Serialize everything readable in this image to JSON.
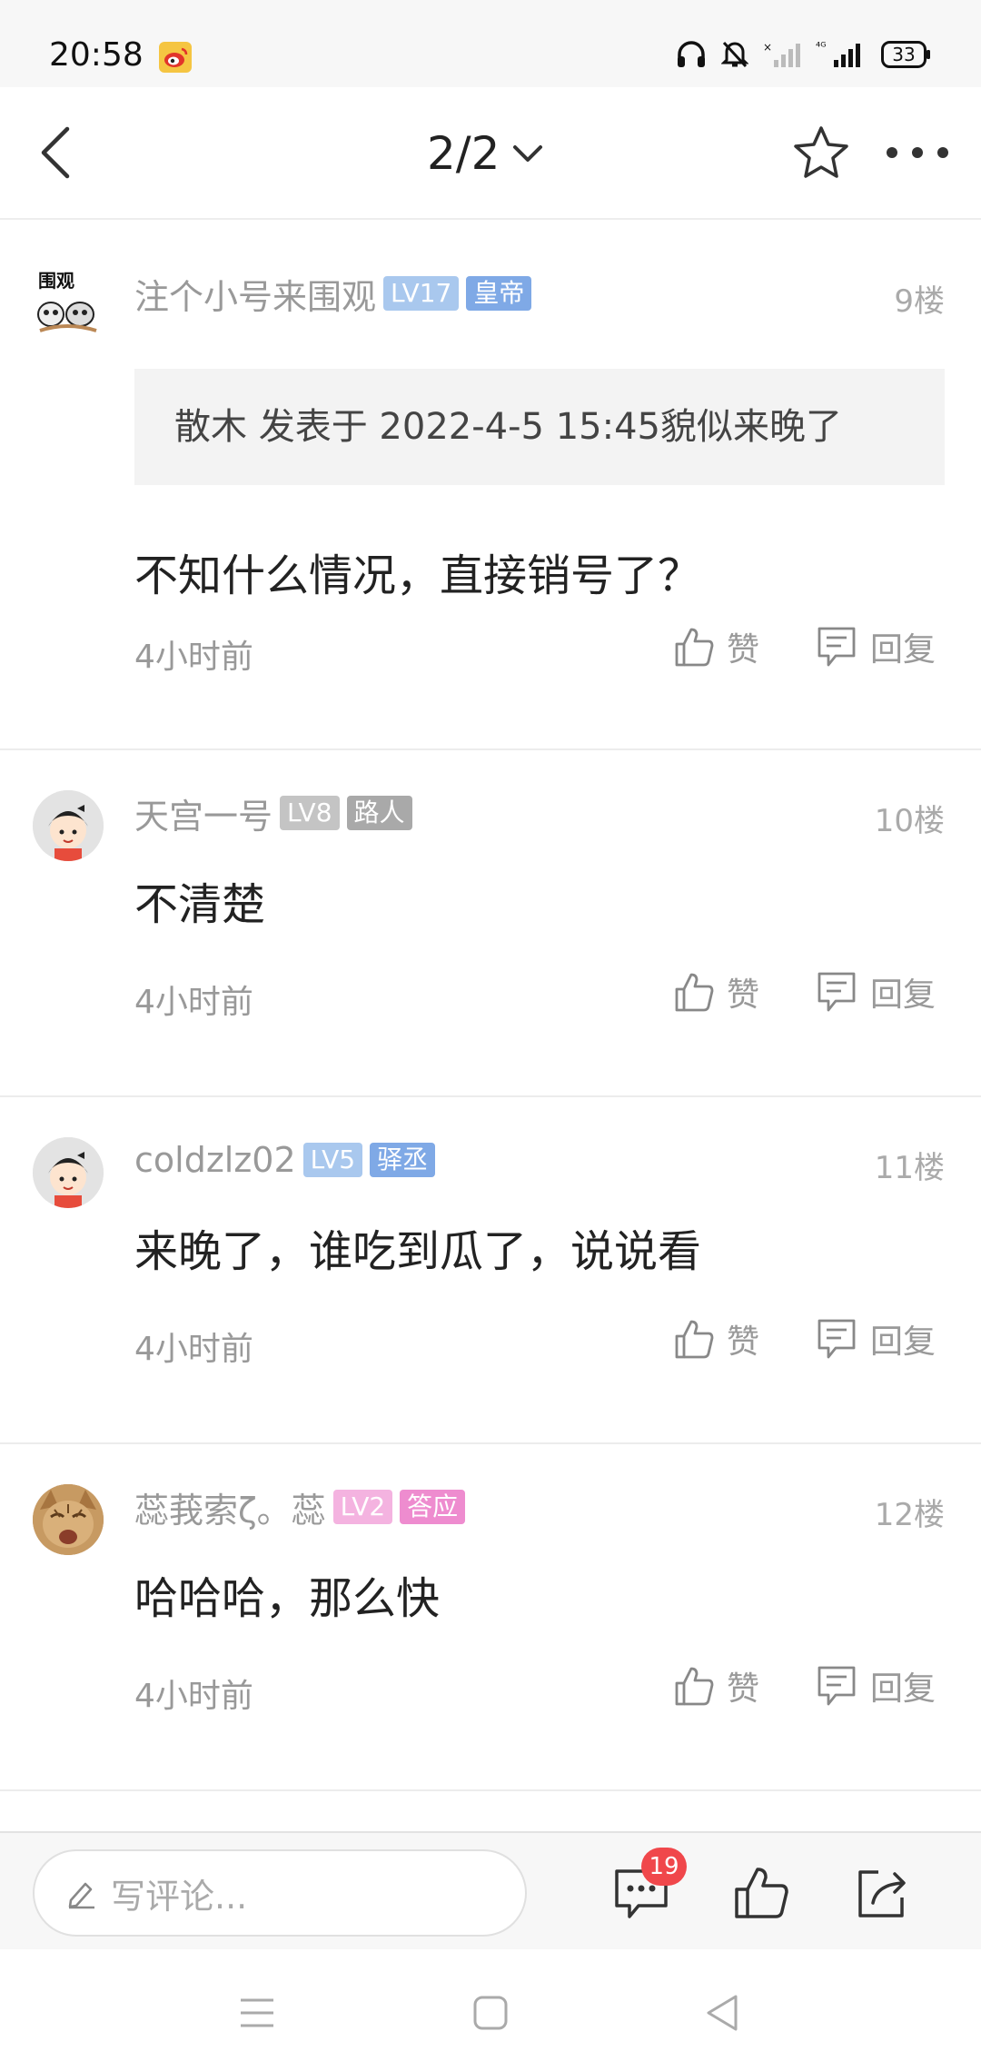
{
  "status_bar": {
    "time": "20:58",
    "battery": "33",
    "icons": [
      "weibo-icon",
      "headphones-icon",
      "mute-icon",
      "signal-weak-icon",
      "4g-signal-icon",
      "battery-icon"
    ]
  },
  "nav": {
    "back_icon": "back-arrow-icon",
    "page_indicator": "2/2",
    "favorite_icon": "star-icon",
    "more_icon": "more-icon"
  },
  "comments": [
    {
      "username": "注个小号来围观",
      "level": "LV17",
      "title": "皇帝",
      "level_color": "#a9c8ee",
      "title_color": "#7fa9e6",
      "floor": "9楼",
      "quote": "散木 发表于 2022-4-5 15:45貌似来晚了",
      "content": "不知什么情况，直接销号了？",
      "time": "4小时前",
      "like_label": "赞",
      "reply_label": "回复"
    },
    {
      "username": "天宫一号",
      "level": "LV8",
      "title": "路人",
      "level_color": "#c4c4c4",
      "title_color": "#a9a9a9",
      "floor": "10楼",
      "content": "不清楚",
      "time": "4小时前",
      "like_label": "赞",
      "reply_label": "回复"
    },
    {
      "username": "coldzlz02",
      "level": "LV5",
      "title": "驿丞",
      "level_color": "#a9c8ee",
      "title_color": "#7fa9e6",
      "floor": "11楼",
      "content": "来晚了，谁吃到瓜了，说说看",
      "time": "4小时前",
      "like_label": "赞",
      "reply_label": "回复"
    },
    {
      "username": "蕊莪索ζ。蕊",
      "level": "LV2",
      "title": "答应",
      "level_color": "#f4b3e0",
      "title_color": "#ee8ccf",
      "floor": "12楼",
      "content": "哈哈哈，那么快",
      "time": "4小时前",
      "like_label": "赞",
      "reply_label": "回复"
    }
  ],
  "bottom_bar": {
    "comment_placeholder": "写评论...",
    "comment_count": "19"
  }
}
